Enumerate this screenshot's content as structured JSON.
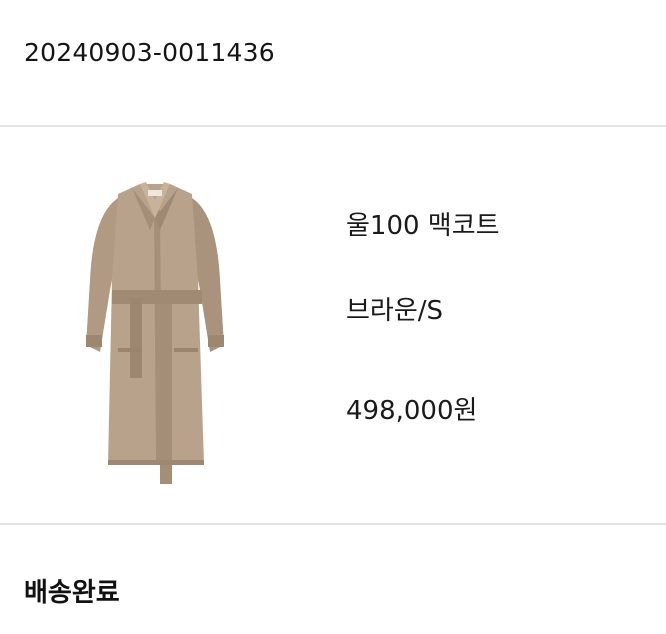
{
  "order": {
    "number": "20240903-0011436"
  },
  "product": {
    "name": "울100 맥코트",
    "option": "브라운/S",
    "price": "498,000원",
    "image_icon": "coat-image",
    "color": "#b5a08a"
  },
  "delivery": {
    "status": "배송완료"
  }
}
